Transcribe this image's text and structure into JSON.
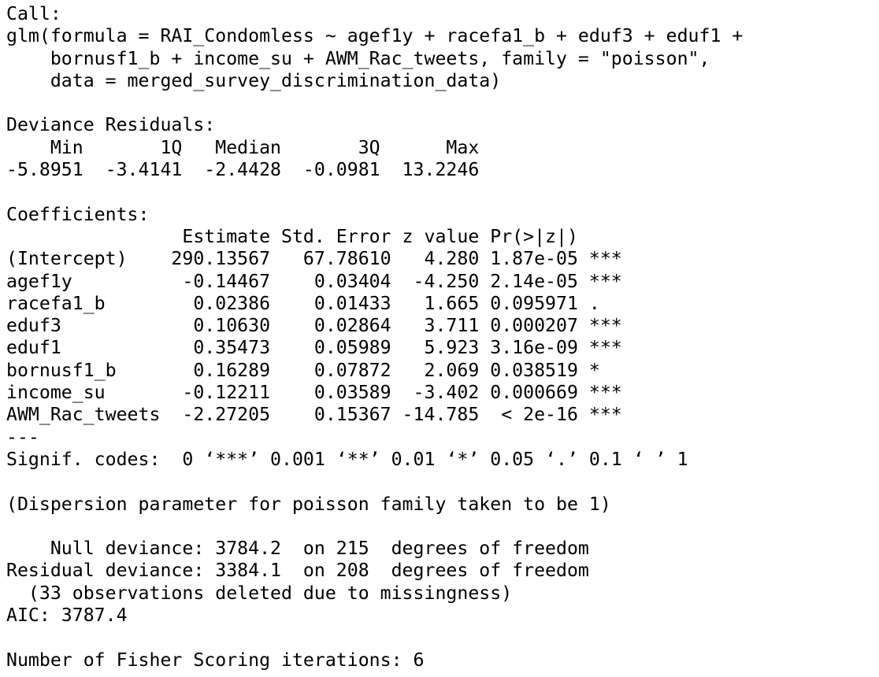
{
  "console": {
    "lines": [
      "Call:",
      "glm(formula = RAI_Condomless ~ agef1y + racefa1_b + eduf3 + eduf1 +",
      "    bornusf1_b + income_su + AWM_Rac_tweets, family = \"poisson\",",
      "    data = merged_survey_discrimination_data)",
      "",
      "Deviance Residuals:",
      "    Min       1Q   Median       3Q      Max",
      "-5.8951  -3.4141  -2.4428  -0.0981  13.2246",
      "",
      "Coefficients:",
      "                Estimate Std. Error z value Pr(>|z|)",
      "(Intercept)    290.13567   67.78610   4.280 1.87e-05 ***",
      "agef1y          -0.14467    0.03404  -4.250 2.14e-05 ***",
      "racefa1_b        0.02386    0.01433   1.665 0.095971 .",
      "eduf3            0.10630    0.02864   3.711 0.000207 ***",
      "eduf1            0.35473    0.05989   5.923 3.16e-09 ***",
      "bornusf1_b       0.16289    0.07872   2.069 0.038519 *",
      "income_su       -0.12211    0.03589  -3.402 0.000669 ***",
      "AWM_Rac_tweets  -2.27205    0.15367 -14.785  < 2e-16 ***",
      "---",
      "Signif. codes:  0 ‘***’ 0.001 ‘**’ 0.01 ‘*’ 0.05 ‘.’ 0.1 ‘ ’ 1",
      "",
      "(Dispersion parameter for poisson family taken to be 1)",
      "",
      "    Null deviance: 3784.2  on 215  degrees of freedom",
      "Residual deviance: 3384.1  on 208  degrees of freedom",
      "  (33 observations deleted due to missingness)",
      "AIC: 3787.4",
      "",
      "Number of Fisher Scoring iterations: 6"
    ]
  }
}
